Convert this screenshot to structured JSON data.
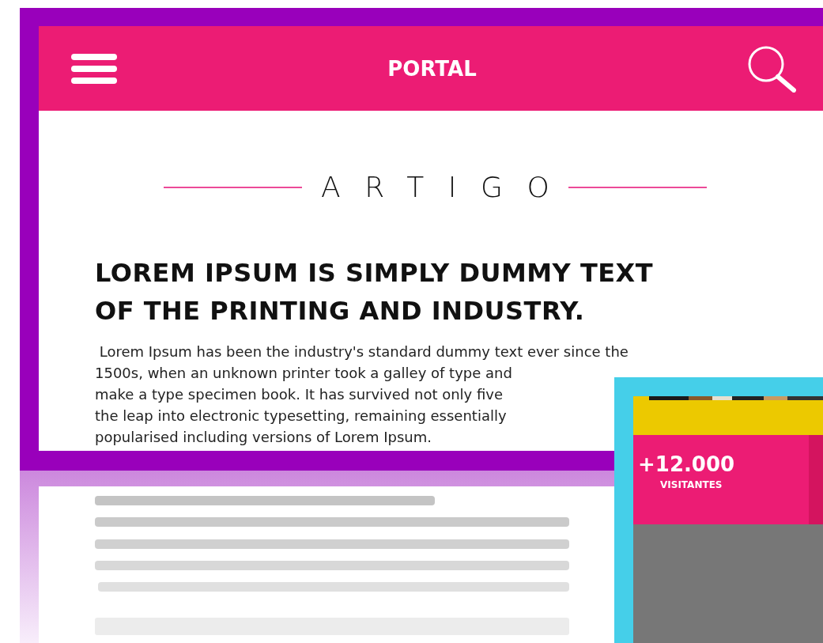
{
  "header": {
    "title": "PORTAL"
  },
  "article": {
    "section": "ARTIGO",
    "headline": [
      "LOREM IPSUM IS SIMPLY DUMMY TEXT",
      "OF THE PRINTING AND INDUSTRY."
    ],
    "paragraph_lines": [
      " Lorem Ipsum has been the industry's standard dummy text ever since the",
      "1500s, when an unknown printer took a galley of type and",
      "make a type specimen book. It has survived not only five",
      "the leap into electronic typesetting, remaining essentially",
      "popularised including versions of Lorem Ipsum."
    ]
  },
  "stat_card": {
    "value": "+12.000",
    "label": "VISITANTES"
  }
}
